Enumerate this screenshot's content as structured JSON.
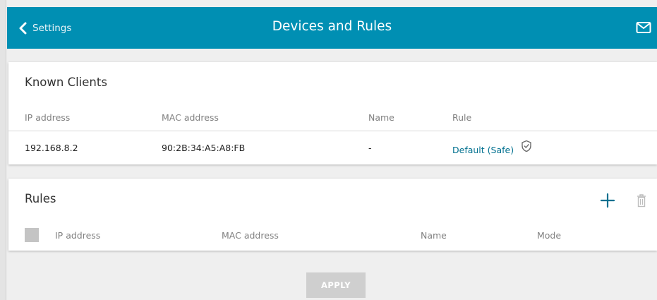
{
  "header": {
    "back_label": "Settings",
    "title": "Devices and Rules",
    "mail_icon": "mail-icon"
  },
  "known_clients": {
    "title": "Known Clients",
    "columns": [
      "IP address",
      "MAC address",
      "Name",
      "Rule"
    ],
    "rows": [
      {
        "ip": "192.168.8.2",
        "mac": "90:2B:34:A5:A8:FB",
        "name": "-",
        "rule": "Default (Safe)",
        "rule_icon": "shield-check-icon"
      }
    ]
  },
  "rules": {
    "title": "Rules",
    "columns": [
      "IP address",
      "MAC address",
      "Name",
      "Mode"
    ],
    "add_icon": "plus-icon",
    "delete_icon": "trash-icon"
  },
  "apply_label": "APPLY",
  "colors": {
    "header_bg": "#008fb3",
    "link": "#00708f",
    "disabled_button": "#cfcfcf"
  }
}
